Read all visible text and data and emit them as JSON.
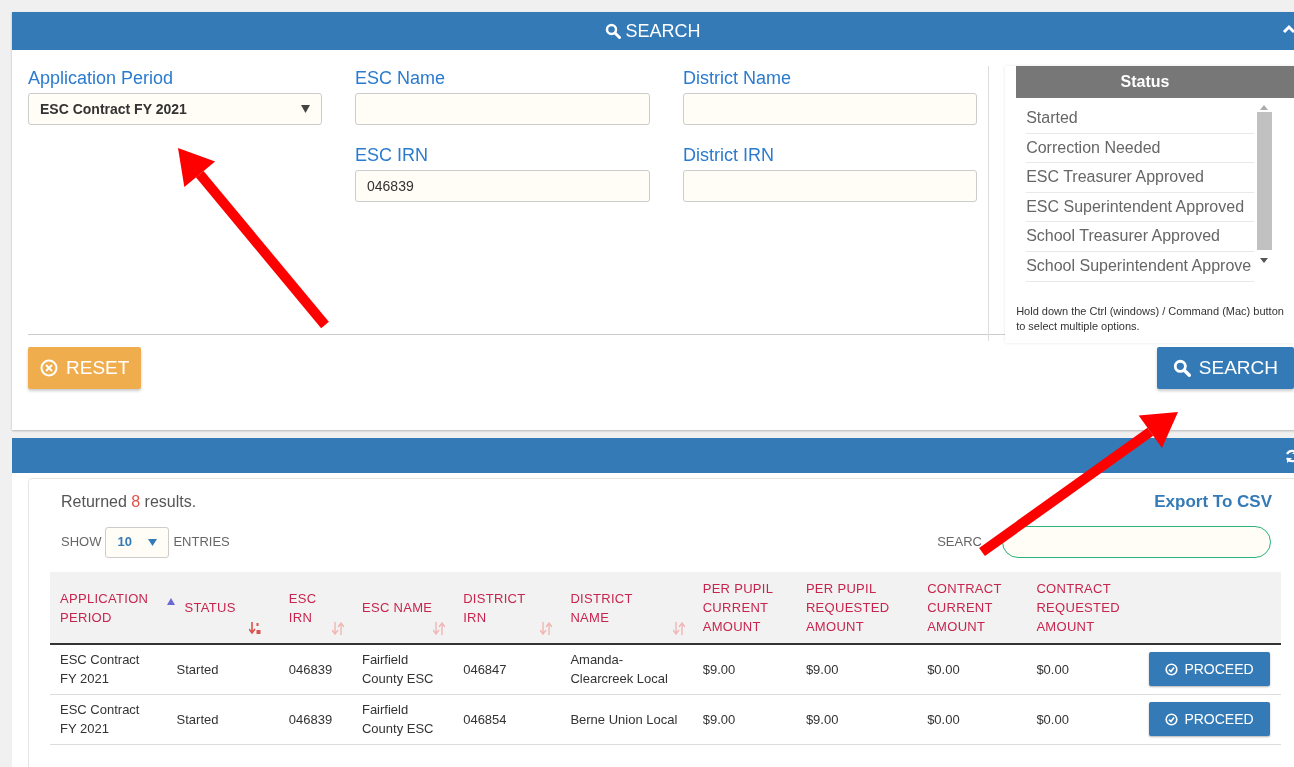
{
  "search_panel": {
    "title": "SEARCH",
    "fields": [
      {
        "label": "Application Period",
        "kind": "select",
        "value": "ESC Contract FY 2021"
      },
      {
        "label": "ESC Name",
        "kind": "text"
      },
      {
        "label": "ESC IRN",
        "kind": "text",
        "value": "046839"
      },
      {
        "label": "District Name",
        "kind": "text"
      },
      {
        "label": "District IRN",
        "kind": "text"
      }
    ],
    "status": {
      "title": "Status",
      "options": [
        {
          "label": "Started",
          "selected": false
        },
        {
          "label": "Correction Needed",
          "selected": false
        },
        {
          "label": "ESC Treasurer Approved",
          "selected": false
        },
        {
          "label": "ESC Superintendent Approved",
          "selected": false
        },
        {
          "label": "School Treasurer Approved",
          "selected": false
        },
        {
          "label": "School Superintendent Approve",
          "selected": false
        }
      ],
      "hint": "Hold down the Ctrl (windows) / Command (Mac) button to select multiple options."
    },
    "reset_button": "RESET",
    "search_button": "SEARCH"
  },
  "results_panel": {
    "summary_before": "Returned ",
    "count": "8",
    "summary_after": " results.",
    "export_link": "Export To CSV",
    "show_label": "SHOW",
    "page_size": "10",
    "entries_label": "ENTRIES",
    "search_label": "SEARC",
    "table": {
      "columns": [
        {
          "label": "APPLICATION PERIOD",
          "sortable": false,
          "sorted": false
        },
        {
          "label": "STATUS",
          "sortable": true,
          "sorted": true
        },
        {
          "label": "ESC IRN",
          "sortable": true,
          "sorted": false
        },
        {
          "label": "ESC NAME",
          "sortable": true,
          "sorted": false
        },
        {
          "label": "DISTRICT IRN",
          "sortable": true,
          "sorted": false
        },
        {
          "label": "DISTRICT NAME",
          "sortable": true,
          "sorted": false
        },
        {
          "label": "PER PUPIL CURRENT AMOUNT",
          "sortable": false,
          "sorted": false
        },
        {
          "label": "PER PUPIL REQUESTED AMOUNT",
          "sortable": false,
          "sorted": false
        },
        {
          "label": "CONTRACT CURRENT AMOUNT",
          "sortable": false,
          "sorted": false
        },
        {
          "label": "CONTRACT REQUESTED AMOUNT",
          "sortable": false,
          "sorted": false
        }
      ],
      "rows": [
        {
          "cells": [
            "ESC Contract FY 2021",
            "Started",
            "046839",
            "Fairfield County ESC",
            "046847",
            "Amanda-Clearcreek Local",
            "$9.00",
            "$9.00",
            "$0.00",
            "$0.00"
          ],
          "action": "PROCEED"
        },
        {
          "cells": [
            "ESC Contract FY 2021",
            "Started",
            "046839",
            "Fairfield County ESC",
            "046854",
            "Berne Union Local",
            "$9.00",
            "$9.00",
            "$0.00",
            "$0.00"
          ],
          "action": "PROCEED"
        }
      ]
    }
  },
  "annotations": [
    {
      "kind": "arrow"
    },
    {
      "kind": "arrow"
    }
  ]
}
